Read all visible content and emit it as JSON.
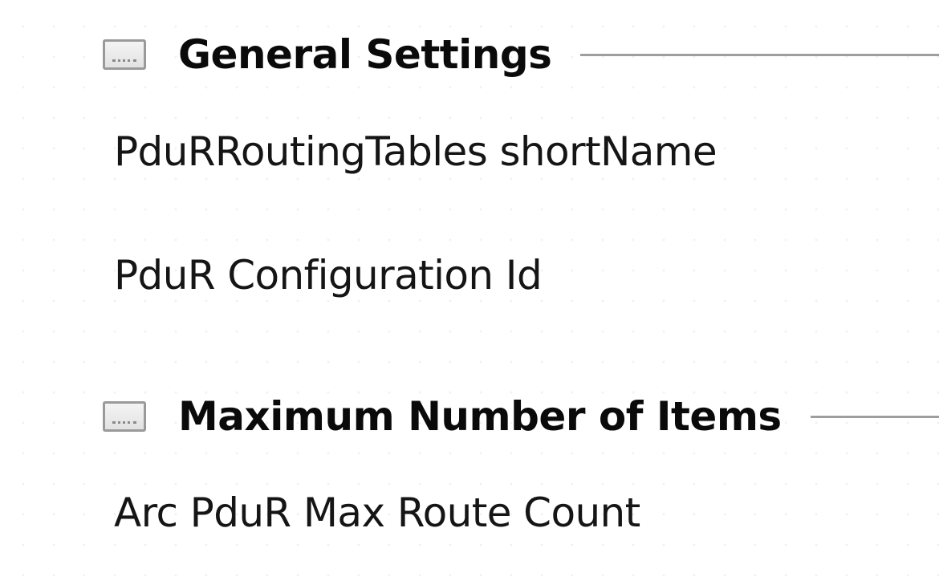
{
  "sections": [
    {
      "title": "General Settings",
      "icon": "collapse-icon",
      "fields": [
        {
          "label": "PduRRoutingTables shortName"
        },
        {
          "label": "PduR Configuration Id"
        }
      ]
    },
    {
      "title": "Maximum Number of Items",
      "icon": "collapse-icon",
      "fields": [
        {
          "label": "Arc PduR Max Route Count"
        }
      ]
    }
  ],
  "colors": {
    "rule": "#9e9e9e",
    "icon_border": "#9a9a9a",
    "text": "#111111"
  }
}
